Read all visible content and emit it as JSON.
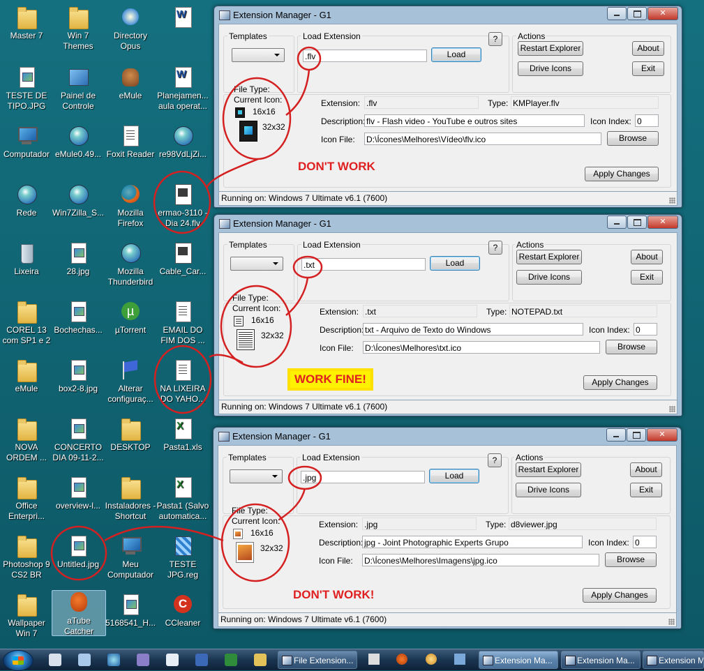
{
  "desktop": {
    "icons": [
      {
        "label": "Master 7"
      },
      {
        "label": "Win 7 Themes"
      },
      {
        "label": "Directory Opus"
      },
      {
        "label": ""
      },
      {
        "label": "TESTE DE TIPO.JPG"
      },
      {
        "label": "Painel de Controle"
      },
      {
        "label": "eMule"
      },
      {
        "label": "Planejamen... aula operat..."
      },
      {
        "label": "Computador"
      },
      {
        "label": "eMule0.49..."
      },
      {
        "label": "Foxit Reader"
      },
      {
        "label": "re98VdLjZi..."
      },
      {
        "label": "Rede"
      },
      {
        "label": "Win7Zilla_S..."
      },
      {
        "label": "Mozilla Firefox"
      },
      {
        "label": "ermao-3110 - Dia 24.flv"
      },
      {
        "label": "Lixeira"
      },
      {
        "label": "28.jpg"
      },
      {
        "label": "Mozilla Thunderbird"
      },
      {
        "label": "Cable_Car..."
      },
      {
        "label": "COREL 13 com SP1 e 2"
      },
      {
        "label": "Bochechas..."
      },
      {
        "label": "µTorrent"
      },
      {
        "label": "EMAIL DO FIM DOS ..."
      },
      {
        "label": "eMule"
      },
      {
        "label": "box2-8.jpg"
      },
      {
        "label": "Alterar configuraç..."
      },
      {
        "label": "NA LIXEIRA DO YAHO..."
      },
      {
        "label": "NOVA ORDEM ..."
      },
      {
        "label": "CONCERTO DIA 09-11-2..."
      },
      {
        "label": "DESKTOP"
      },
      {
        "label": "Pasta1.xls"
      },
      {
        "label": "Office Enterpri..."
      },
      {
        "label": "overview-l..."
      },
      {
        "label": "Instaladores - Shortcut"
      },
      {
        "label": "Pasta1 (Salvo automatica..."
      },
      {
        "label": "Photoshop 9 CS2 BR"
      },
      {
        "label": "Untitled.jpg"
      },
      {
        "label": "Meu Computador"
      },
      {
        "label": "TESTE JPG.reg"
      },
      {
        "label": "Wallpaper Win 7"
      },
      {
        "label": "aTube Catcher"
      },
      {
        "label": "5168541_H..."
      },
      {
        "label": "CCleaner"
      }
    ]
  },
  "window_common": {
    "title": "Extension Manager - G1",
    "templates_label": "Templates",
    "load_extension_label": "Load Extension",
    "help_label": "?",
    "load_button": "Load",
    "actions_label": "Actions",
    "restart_explorer": "Restart Explorer",
    "about": "About",
    "drive_icons": "Drive Icons",
    "exit": "Exit",
    "file_type_label": "File Type:",
    "current_icon_label": "Current Icon:",
    "size16": "16x16",
    "size32": "32x32",
    "extension_label": "Extension:",
    "type_label": "Type:",
    "description_label": "Description:",
    "icon_index_label": "Icon Index:",
    "icon_file_label": "Icon File:",
    "browse": "Browse",
    "apply_changes": "Apply Changes",
    "status": "Running on: Windows 7 Ultimate v6.1 (7600)"
  },
  "windows": [
    {
      "load_value": ".flv",
      "extension": ".flv",
      "type": "KMPlayer.flv",
      "description": "flv - Flash video - YouTube e outros sites",
      "icon_index": "0",
      "icon_file": "D:\\Ícones\\Melhores\\Vídeo\\flv.ico",
      "annotation": "DON'T WORK"
    },
    {
      "load_value": ".txt",
      "extension": ".txt",
      "type": "NOTEPAD.txt",
      "description": "txt - Arquivo de Texto do Windows",
      "icon_index": "0",
      "icon_file": "D:\\Ícones\\Melhores\\txt.ico",
      "annotation": "WORK FINE!"
    },
    {
      "load_value": ".jpg",
      "extension": ".jpg",
      "type": "d8viewer.jpg",
      "description": "jpg - Joint Photographic Experts Grupo",
      "icon_index": "0",
      "icon_file": "D:\\Ícones\\Melhores\\Imagens\\jpg.ico",
      "annotation": "DON'T WORK!"
    }
  ],
  "taskbar": {
    "tasks": [
      {
        "label": "File Extension..."
      },
      {
        "label": "Extension Ma..."
      },
      {
        "label": "Extension Ma..."
      },
      {
        "label": "Extension M"
      }
    ]
  },
  "colors": {
    "annotation_red": "#e02020",
    "highlight_yellow": "#fff200",
    "desktop_teal": "#14707f"
  }
}
